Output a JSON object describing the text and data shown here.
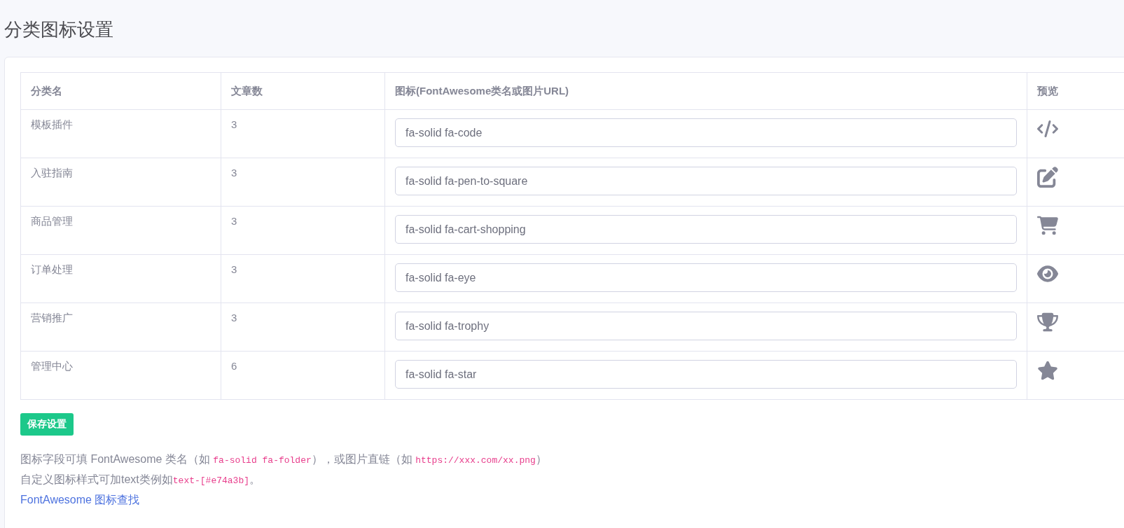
{
  "page_title": "分类图标设置",
  "table": {
    "columns": [
      "分类名",
      "文章数",
      "图标(FontAwesome类名或图片URL)",
      "预览"
    ],
    "rows": [
      {
        "name": "模板插件",
        "count": "3",
        "icon_value": "fa-solid fa-code",
        "kind": "code"
      },
      {
        "name": "入驻指南",
        "count": "3",
        "icon_value": "fa-solid fa-pen-to-square",
        "kind": "edit"
      },
      {
        "name": "商品管理",
        "count": "3",
        "icon_value": "fa-solid fa-cart-shopping",
        "kind": "cart"
      },
      {
        "name": "订单处理",
        "count": "3",
        "icon_value": "fa-solid fa-eye",
        "kind": "eye"
      },
      {
        "name": "营销推广",
        "count": "3",
        "icon_value": "fa-solid fa-trophy",
        "kind": "trophy"
      },
      {
        "name": "管理中心",
        "count": "6",
        "icon_value": "fa-solid fa-star",
        "kind": "star"
      }
    ]
  },
  "save_button": "保存设置",
  "help_lines": [
    [
      {
        "kind": "text",
        "text": "图标字段可填 FontAwesome 类名（如 "
      },
      {
        "kind": "code",
        "text": "fa-solid fa-folder"
      },
      {
        "kind": "text",
        "text": "），或图片直链（如 "
      },
      {
        "kind": "code",
        "text": "https://xxx.com/xx.png"
      },
      {
        "kind": "text",
        "text": "）"
      }
    ],
    [
      {
        "kind": "text",
        "text": "自定义图标样式可加text类例如"
      },
      {
        "kind": "code",
        "text": "text-[#e74a3b]"
      },
      {
        "kind": "text",
        "text": "。"
      }
    ]
  ],
  "help_link": "FontAwesome 图标查找"
}
